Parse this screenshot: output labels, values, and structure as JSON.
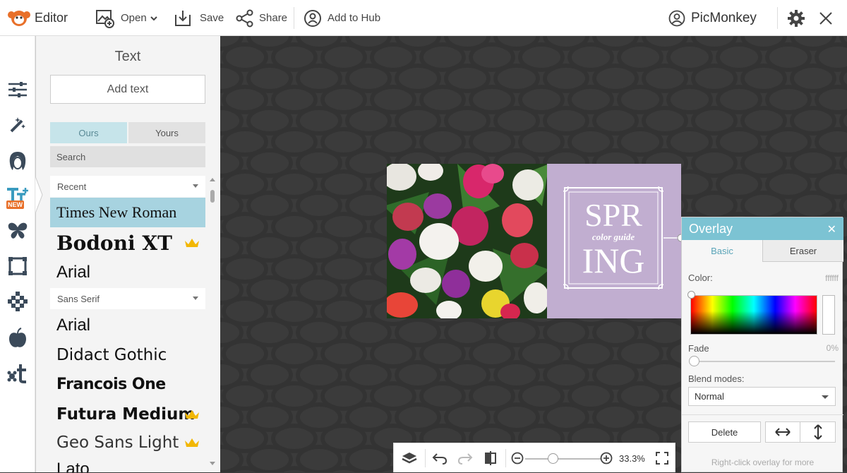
{
  "topbar": {
    "app_title": "Editor",
    "open_label": "Open",
    "save_label": "Save",
    "share_label": "Share",
    "hub_label": "Add to Hub",
    "account_label": "PicMonkey"
  },
  "rail": {
    "items": [
      "adjust-icon",
      "touch-up-wand-icon",
      "face-icon",
      "text-icon",
      "butterfly-icon",
      "frame-icon",
      "texture-icon",
      "apple-icon",
      "themes-icon"
    ],
    "new_badge": "NEW"
  },
  "panel": {
    "title": "Text",
    "add_text_label": "Add text",
    "tabs": [
      "Ours",
      "Yours"
    ],
    "search_placeholder": "Search",
    "categories": {
      "recent": "Recent",
      "sans_serif": "Sans Serif"
    },
    "recent_fonts": [
      {
        "name": "Times New Roman",
        "selected": true,
        "premium": false
      },
      {
        "name": "Bodoni XT",
        "selected": false,
        "premium": true
      },
      {
        "name": "Arial",
        "selected": false,
        "premium": false
      }
    ],
    "sans_fonts": [
      {
        "name": "Arial",
        "premium": false
      },
      {
        "name": "Didact Gothic",
        "premium": false
      },
      {
        "name": "Francois One",
        "premium": false
      },
      {
        "name": "Futura Medium",
        "premium": true
      },
      {
        "name": "Geo Sans Light",
        "premium": true
      },
      {
        "name": "Lato",
        "premium": false
      }
    ]
  },
  "canvas": {
    "overlay_text_top": "SPR",
    "overlay_text_mid": "color guide",
    "overlay_text_bottom": "ING",
    "panel_color": "#c1aed0"
  },
  "overlay_dialog": {
    "title": "Overlay",
    "tab_basic": "Basic",
    "tab_eraser": "Eraser",
    "color_label": "Color:",
    "color_value": "ffffff",
    "fade_label": "Fade",
    "fade_value": "0%",
    "blend_label": "Blend modes:",
    "blend_value": "Normal",
    "delete_label": "Delete",
    "hint": "Right-click overlay for more"
  },
  "bottombar": {
    "zoom_value": "33.3%"
  },
  "colors": {
    "accent": "#7cc3d3",
    "selected_font_bg": "#a7d3e0",
    "crown": "#f2b705",
    "logo": "#e8702a"
  }
}
